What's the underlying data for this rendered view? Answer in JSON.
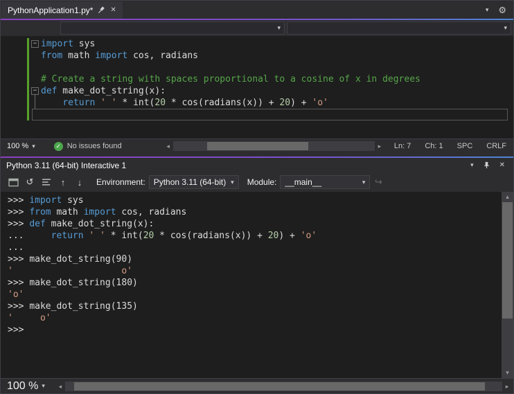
{
  "colors": {
    "chrome": "#2d2d30",
    "editor_bg": "#1e1e1e",
    "border": "#3f3f46",
    "accent_start": "#8b3fbf",
    "accent_end": "#4e86d4",
    "keyword": "#569cd6",
    "string": "#d69d85",
    "comment": "#57a64a",
    "number": "#b5cea8",
    "code_text": "#dcdcdc",
    "change_bar": "#5aa02c",
    "check_green": "#4ca64c",
    "scroll_track": "#3e3e42",
    "scroll_thumb": "#686868"
  },
  "icons": {
    "chevron_down": "▾",
    "close": "✕",
    "gear": "⚙",
    "reset": "↺",
    "up_arrow": "↑",
    "down_arrow": "↓",
    "curved_arrow": "↪",
    "check": "✓",
    "fold_collapse": "−",
    "left_triangle": "◂",
    "right_triangle": "▸",
    "up_triangle": "▴",
    "down_triangle": "▾"
  },
  "tab": {
    "title": "PythonApplication1.py*"
  },
  "editor": {
    "code": [
      {
        "fold": true,
        "tokens": [
          [
            "k",
            "import"
          ],
          [
            "p",
            " sys"
          ]
        ]
      },
      {
        "tokens": [
          [
            "k",
            "from"
          ],
          [
            "p",
            " math "
          ],
          [
            "k",
            "import"
          ],
          [
            "p",
            " cos, radians"
          ]
        ]
      },
      {
        "tokens": []
      },
      {
        "tokens": [
          [
            "c",
            "# Create a string with spaces proportional to a cosine of x in degrees"
          ]
        ]
      },
      {
        "fold": true,
        "tokens": [
          [
            "k",
            "def"
          ],
          [
            "p",
            " make_dot_string(x):"
          ]
        ]
      },
      {
        "tokens": [
          [
            "p",
            "    "
          ],
          [
            "k",
            "return"
          ],
          [
            "p",
            " "
          ],
          [
            "s",
            "' '"
          ],
          [
            "p",
            " * int("
          ],
          [
            "n",
            "20"
          ],
          [
            "p",
            " * cos(radians(x)) + "
          ],
          [
            "n",
            "20"
          ],
          [
            "p",
            ") + "
          ],
          [
            "s",
            "'o'"
          ]
        ]
      },
      {
        "caret": true,
        "tokens": []
      }
    ],
    "status": {
      "zoom": "100 %",
      "issues": "No issues found",
      "line": "Ln: 7",
      "column": "Ch: 1",
      "spaces": "SPC",
      "line_ending": "CRLF"
    }
  },
  "interactive": {
    "title": "Python 3.11 (64-bit) Interactive 1",
    "toolbar": {
      "environment_label": "Environment:",
      "environment_value": "Python 3.11 (64-bit)",
      "module_label": "Module:",
      "module_value": "__main__"
    },
    "lines": [
      [
        [
          "pr",
          ">>> "
        ],
        [
          "k",
          "import"
        ],
        [
          "p",
          " sys"
        ]
      ],
      [
        [
          "pr",
          ">>> "
        ],
        [
          "k",
          "from"
        ],
        [
          "p",
          " math "
        ],
        [
          "k",
          "import"
        ],
        [
          "p",
          " cos, radians"
        ]
      ],
      [
        [
          "pr",
          ">>> "
        ],
        [
          "k",
          "def"
        ],
        [
          "p",
          " make_dot_string(x):"
        ]
      ],
      [
        [
          "pr",
          "... "
        ],
        [
          "p",
          "    "
        ],
        [
          "k",
          "return"
        ],
        [
          "p",
          " "
        ],
        [
          "s",
          "' '"
        ],
        [
          "p",
          " * int("
        ],
        [
          "n",
          "20"
        ],
        [
          "p",
          " * cos(radians(x)) + "
        ],
        [
          "n",
          "20"
        ],
        [
          "p",
          ") + "
        ],
        [
          "s",
          "'o'"
        ]
      ],
      [
        [
          "pr",
          "... "
        ]
      ],
      [
        [
          "pr",
          ">>> "
        ],
        [
          "p",
          "make_dot_string(90)"
        ]
      ],
      [
        [
          "s",
          "'                    o'"
        ]
      ],
      [
        [
          "pr",
          ">>> "
        ],
        [
          "p",
          "make_dot_string(180)"
        ]
      ],
      [
        [
          "s",
          "'o'"
        ]
      ],
      [
        [
          "pr",
          ">>> "
        ],
        [
          "p",
          "make_dot_string(135)"
        ]
      ],
      [
        [
          "s",
          "'     o'"
        ]
      ],
      [
        [
          "pr",
          ">>> "
        ]
      ]
    ],
    "zoom": "100 %"
  }
}
